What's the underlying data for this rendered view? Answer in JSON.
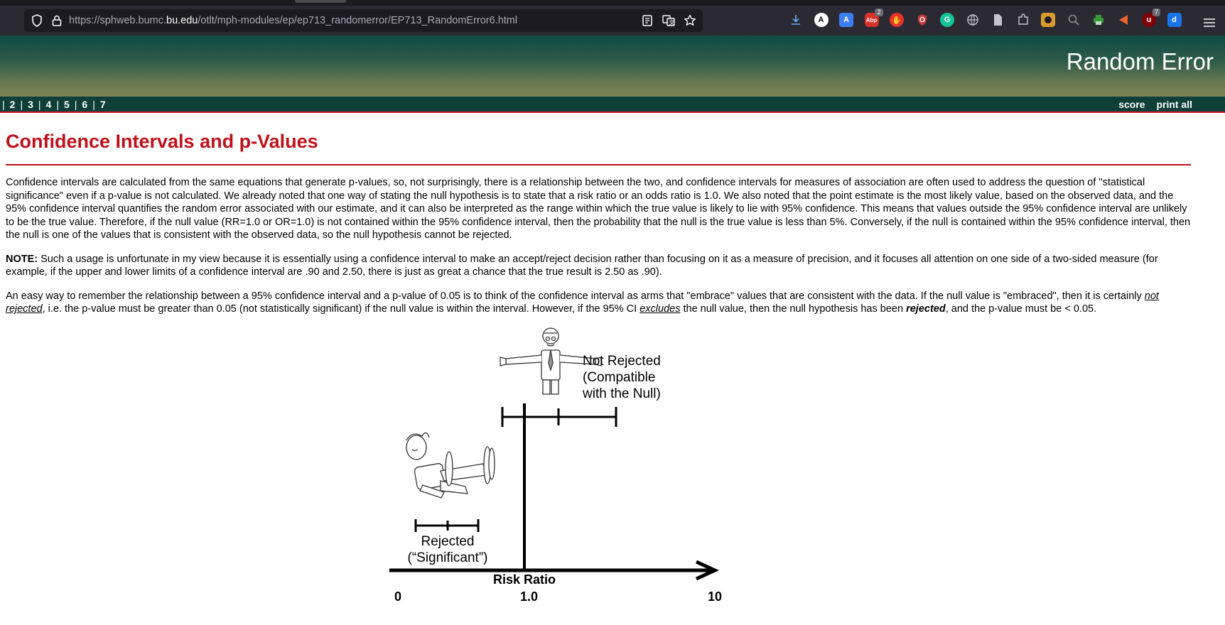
{
  "browser": {
    "url_prefix": "https://sphweb.bumc.",
    "url_domain": "bu.edu",
    "url_suffix": "/otlt/mph-modules/ep/ep713_randomerror/EP713_RandomError6.html",
    "extensions": [
      {
        "icon": "download-icon",
        "color": "#5fb3f5",
        "label": "",
        "badge": ""
      },
      {
        "icon": "a-circle-icon",
        "color": "#ffffff",
        "label": "A",
        "badge": ""
      },
      {
        "icon": "translate-icon",
        "color": "#3d7ef5",
        "label": "A",
        "badge": ""
      },
      {
        "icon": "abp-icon",
        "color": "#d9302a",
        "label": "Abp",
        "badge": "2"
      },
      {
        "icon": "hand-stop-icon",
        "color": "#e8332d",
        "label": "",
        "badge": ""
      },
      {
        "icon": "shield-ublock-icon",
        "color": "#c9373b",
        "label": "",
        "badge": ""
      },
      {
        "icon": "grammarly-icon",
        "color": "#15c39a",
        "label": "G",
        "badge": ""
      },
      {
        "icon": "globe-icon",
        "color": "#c4c4cc",
        "label": "",
        "badge": ""
      },
      {
        "icon": "page-icon",
        "color": "#c4c4cc",
        "label": "",
        "badge": ""
      },
      {
        "icon": "extensions-puzzle-icon",
        "color": "#c4c4cc",
        "label": "",
        "badge": ""
      },
      {
        "icon": "dark-reader-icon",
        "color": "#d89a2b",
        "label": "",
        "badge": ""
      },
      {
        "icon": "magnifier-icon",
        "color": "#8a8a8a",
        "label": "",
        "badge": ""
      },
      {
        "icon": "printer-icon",
        "color": "#3c9a3c",
        "label": "",
        "badge": ""
      },
      {
        "icon": "arrow-clip-icon",
        "color": "#e8632d",
        "label": "",
        "badge": ""
      },
      {
        "icon": "ublock-badge-icon",
        "color": "#800000",
        "label": "",
        "badge": "7"
      },
      {
        "icon": "d-box-icon",
        "color": "#1a73e8",
        "label": "d",
        "badge": ""
      }
    ]
  },
  "site": {
    "title": "Random Error",
    "page_links": [
      "2",
      "3",
      "4",
      "5",
      "6",
      "7"
    ],
    "score_label": "score",
    "print_label": "print all"
  },
  "article": {
    "heading": "Confidence Intervals and p-Values",
    "paragraph1": "Confidence intervals are calculated from the same equations that generate p-values, so, not surprisingly, there is a relationship between the two, and confidence intervals for measures of association are often used to address the question of \"statistical significance\" even if a p-value is not calculated. We already noted that one way of stating the null hypothesis is to state that a risk ratio or an odds ratio is 1.0. We also noted that the point estimate is the most likely value, based on the observed data, and the 95% confidence interval quantifies the random error associated with our estimate, and it can also be interpreted as the range within which the true value is likely to lie with 95% confidence. This means that values outside the 95% confidence interval are unlikely to be the true value. Therefore, if the null value (RR=1.0 or OR=1.0) is not contained within the 95% confidence interval, then the probability that the null is the true value is less than 5%. Conversely, if the null is contained within the 95% confidence interval, then the null is one of the values that is consistent with the observed data, so the null hypothesis cannot be rejected.",
    "note_label": "NOTE:",
    "note_text": " Such a usage is unfortunate in my view because it is essentially using a confidence interval to make an accept/reject decision rather than focusing on it as a measure of precision, and it focuses all attention on one side of a two-sided measure (for example, if the upper and lower limits of a confidence interval are .90 and 2.50, there is just as great a chance that the true result is 2.50 as .90).",
    "p3_a": "An easy way to remember the relationship between a 95% confidence interval and a p-value of 0.05 is to think of the confidence interval as arms that \"embrace\" values that are consistent with the data. If the null value is \"embraced\", then it is certainly ",
    "p3_not_rejected": "not rejected",
    "p3_b": ", i.e. the p-value must be greater than 0.05 (not statistically significant) if the null value is within the interval. However, if the 95% CI ",
    "p3_excludes": "excludes",
    "p3_c": " the null value, then the null hypothesis has been ",
    "p3_rejected": "rejected",
    "p3_d": ", and the p-value must be < 0.05."
  },
  "figure": {
    "not_rejected_line1": "Not Rejected",
    "not_rejected_line2": "(Compatible",
    "not_rejected_line3": "with the Null)",
    "rejected_line1": "Rejected",
    "rejected_line2": "(“Significant”)",
    "axis_label": "Risk Ratio",
    "tick_0": "0",
    "tick_1": "1.0",
    "tick_10": "10"
  }
}
